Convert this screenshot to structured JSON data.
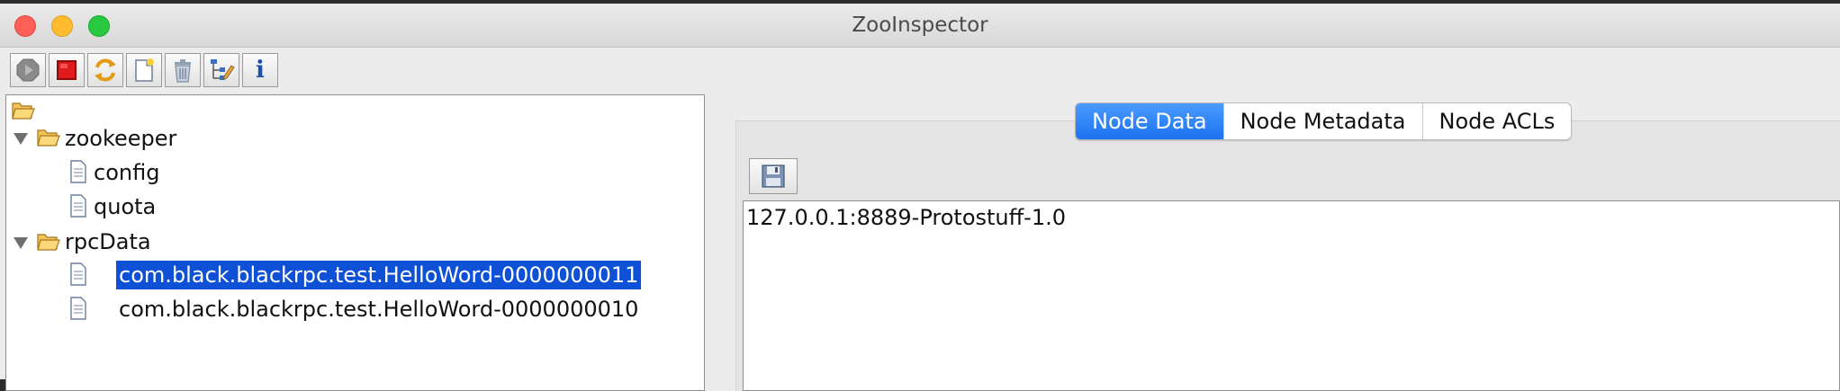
{
  "window": {
    "title": "ZooInspector"
  },
  "toolbar": {
    "buttons": [
      {
        "name": "connect",
        "icon": "connect-icon"
      },
      {
        "name": "disconnect",
        "icon": "stop-icon"
      },
      {
        "name": "refresh",
        "icon": "refresh-icon"
      },
      {
        "name": "add-node",
        "icon": "new-node-icon"
      },
      {
        "name": "delete-node",
        "icon": "trash-icon"
      },
      {
        "name": "node-viewers",
        "icon": "tree-edit-icon"
      },
      {
        "name": "about",
        "icon": "info-icon"
      }
    ],
    "about_glyph": "i"
  },
  "tree": {
    "items": [
      {
        "label": "zookeeper"
      },
      {
        "label": "config"
      },
      {
        "label": "quota"
      },
      {
        "label": "rpcData"
      },
      {
        "label": "com.black.blackrpc.test.HelloWord-0000000011",
        "selected": true
      },
      {
        "label": "com.black.blackrpc.test.HelloWord-0000000010"
      }
    ]
  },
  "tabs": [
    {
      "label": "Node Data",
      "active": true
    },
    {
      "label": "Node Metadata"
    },
    {
      "label": "Node ACLs"
    }
  ],
  "node_data": {
    "content": "127.0.0.1:8889-Protostuff-1.0"
  },
  "colors": {
    "selection": "#0e50d6",
    "tab_active": "#1b72f0",
    "folder": "#f4c35a"
  }
}
